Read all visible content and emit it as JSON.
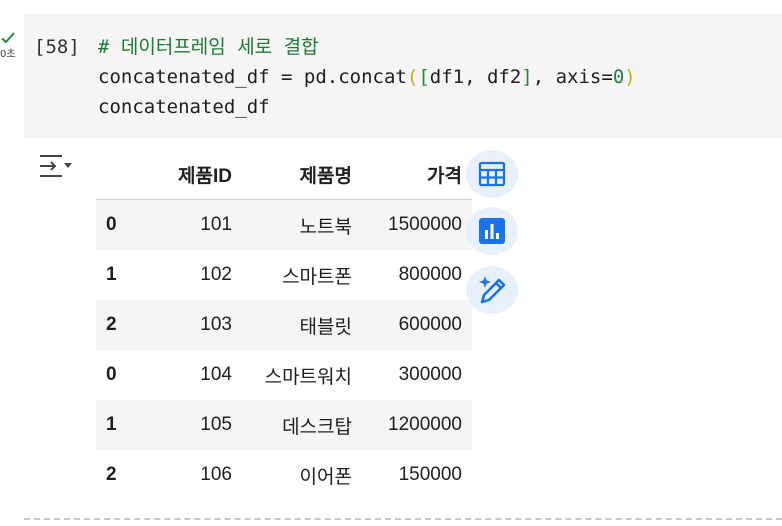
{
  "cell": {
    "exec_count": "[58]",
    "exec_time": "0초",
    "code_lines": [
      "# 데이터프레임 세로 결합",
      "concatenated_df = pd.concat([df1, df2], axis=0)",
      "concatenated_df"
    ],
    "code_parts": {
      "comment": "# 데이터프레임 세로 결합",
      "line2_a": "concatenated_df = pd.concat(",
      "line2_b1": "(",
      "line2_b2": "[",
      "line2_c": "df1, df2",
      "line2_d": "]",
      "line2_e": ", axis=",
      "line2_f": "0",
      "line2_g": ")",
      "line3": "concatenated_df"
    }
  },
  "table": {
    "columns": [
      "",
      "제품ID",
      "제품명",
      "가격"
    ],
    "rows": [
      {
        "index": "0",
        "id": "101",
        "name": "노트북",
        "price": "1500000"
      },
      {
        "index": "1",
        "id": "102",
        "name": "스마트폰",
        "price": "800000"
      },
      {
        "index": "2",
        "id": "103",
        "name": "태블릿",
        "price": "600000"
      },
      {
        "index": "0",
        "id": "104",
        "name": "스마트워치",
        "price": "300000"
      },
      {
        "index": "1",
        "id": "105",
        "name": "데스크탑",
        "price": "1200000"
      },
      {
        "index": "2",
        "id": "106",
        "name": "이어폰",
        "price": "150000"
      }
    ]
  },
  "icons": {
    "status": "check-icon",
    "toggle": "output-toggle-icon",
    "table_btn": "table-icon",
    "chart_btn": "bar-chart-icon",
    "magic_btn": "magic-wand-icon"
  },
  "colors": {
    "accent": "#1a73e8",
    "button_bg": "#e8f0fe",
    "comment": "#1d7a33",
    "cell_bg": "#f5f5f5",
    "success": "#1e8e3e"
  }
}
